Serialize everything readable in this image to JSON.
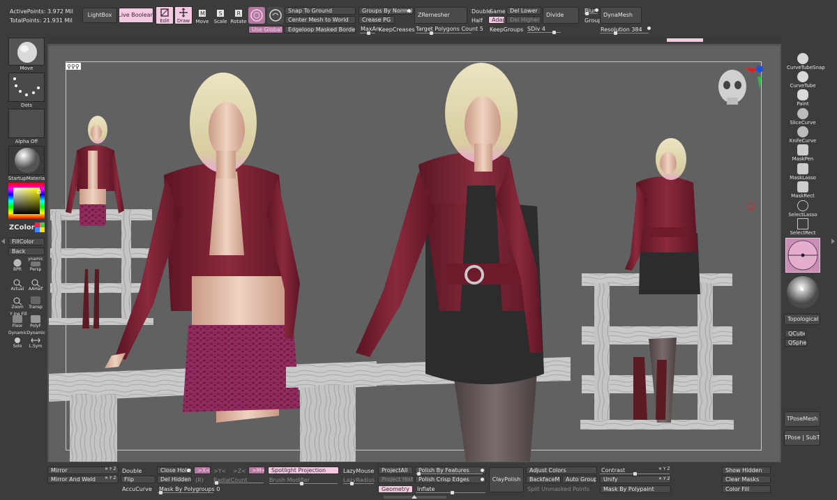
{
  "stats": {
    "active_points": "ActivePoints: 3.972 Mil",
    "total_points": "TotalPoints: 21.931 Mil"
  },
  "topbar": {
    "lightbox": "LightBox",
    "live_boolean": "Live Boolean",
    "tools": {
      "edit": "Edit",
      "draw": "Draw",
      "move": "Move",
      "scale": "Scale",
      "rotate": "Rotate"
    },
    "use_global": "Use Global",
    "snap_to_ground": "Snap To Ground",
    "center_mesh": "Center Mesh to World",
    "edgeloop_masked": "Edgeloop Masked Border",
    "groups_by_normals": "Groups By Normals",
    "crease_pg": "Crease PG",
    "maxan": "MaxAn",
    "keep_creases": "KeepCreases",
    "zremesher": "ZRemesher",
    "target_polygons": "Target Polygons Count 5",
    "double": "Double",
    "half": "Half",
    "same": "Same",
    "adapt": "Adapt",
    "keep_groups": "KeepGroups",
    "del_lower": "Del Lower",
    "del_higher": "Del Higher",
    "sdiv": "SDiv 4",
    "divide": "Divide",
    "blur": "Blur",
    "groups": "Groups",
    "dynamesh": "DynaMesh",
    "resolution": "Resolution 384"
  },
  "left_shelf": {
    "move": "Move",
    "dots": "Dots",
    "alpha_off": "Alpha Off",
    "startup_material": "StartupMateria",
    "zcolor": "ZColor",
    "fillcolor": "FillColor",
    "back": "Back",
    "bpr": "BPR",
    "persp": "Persp",
    "dynamic": "ynamic",
    "actual": "Actual",
    "aahalf": "AAHalf",
    "zoom": "Zoom",
    "transp": "Transp",
    "floor": "Floor",
    "polyf": "PolyF",
    "xyz_fill": "Y    ine Fill",
    "dynamic_dynamic": "DynamicDynamic",
    "solo": "Solo",
    "lsym": "L.Sym"
  },
  "right_shelf": {
    "brushes": [
      "CurveTubeSnap",
      "CurveTube",
      "Paint",
      "SliceCurve",
      "KnifeCurve",
      "MaskPen",
      "MaskLasso",
      "MaskRect",
      "SelectLasso",
      "SelectRect"
    ],
    "topological": "Topological",
    "qcube": "QCube",
    "qsphere": "QSphere",
    "tpose_mesh": "TPoseMesh",
    "tpose_subt": "TPose | SubT"
  },
  "bottombar": {
    "mirror": "Mirror",
    "mirror_and_weld": "Mirror And Weld",
    "double": "Double",
    "flip": "Flip",
    "accucurve": "AccuCurve",
    "close_holes": "Close Holes",
    "del_hidden": "Del Hidden",
    "mask_by_polygroups": "Mask By Polygroups 0",
    "x_axis": ">X<",
    "y_axis": ">Y<",
    "z_axis": ">Z<",
    "m_axis": ">M<",
    "r": "(R)",
    "radial_count": "RadialCount",
    "spotlight": "Spotlight Projection",
    "brush_modifier": "Brush Modifier",
    "lazymouse": "LazyMouse",
    "lazyradius": "LazyRadius",
    "project_all": "ProjectAll",
    "project_history": "Project History",
    "geometry": "Geometry",
    "polish_by_features": "Polish By Features",
    "polish_crisp_edges": "Polish Crisp Edges",
    "inflate": "Inflate",
    "claypolish": "ClayPolish",
    "adjust_colors": "Adjust Colors",
    "backface_mask": "BackfaceMask",
    "auto_groups": "Auto Groups",
    "split_unmasked": "Split Unmasked Points",
    "contrast": "Contrast",
    "unify": "Unify",
    "mask_by_polypaint": "Mask By Polypaint",
    "show_hidden": "Show Hidden",
    "clear_masks": "Clear Masks",
    "color_fill": "Color Fill",
    "xyz": "✕ Y Z"
  },
  "colors": {
    "accent_pink": "#f3c9e2",
    "jacket": "#7a1f30",
    "skirt": "#8c2a5c",
    "dress": "#2c2c2c",
    "hair": "#e6dcb4",
    "fence": "#c8c8c8",
    "skin": "#e8c7b2"
  }
}
